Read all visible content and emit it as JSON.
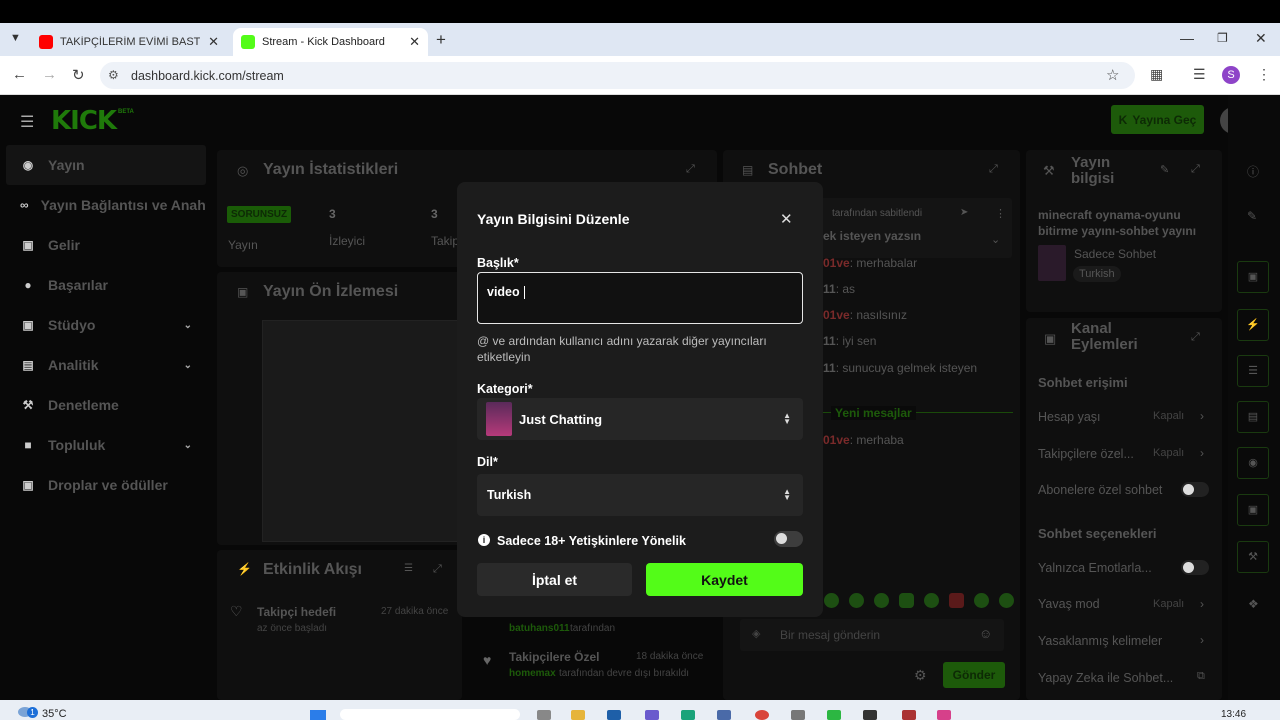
{
  "browser": {
    "tabs": [
      {
        "title": "TAKİPÇİLERİM EVİMİ BASTII | ST",
        "favicon": "youtube-icon"
      },
      {
        "title": "Stream - Kick Dashboard",
        "favicon": "kick-icon"
      }
    ],
    "url": "dashboard.kick.com/stream",
    "profile_initial": "S"
  },
  "header": {
    "logo": "KICK",
    "logo_badge": "BETA",
    "go_live_label": "Yayına Geç"
  },
  "sidebar": {
    "items": [
      {
        "label": "Yayın",
        "icon": "radio-icon"
      },
      {
        "label": "Yayın Bağlantısı ve Anahtarı",
        "icon": "link-icon"
      },
      {
        "label": "Gelir",
        "icon": "wallet-icon"
      },
      {
        "label": "Başarılar",
        "icon": "trophy-icon"
      },
      {
        "label": "Stüdyo",
        "icon": "studio-icon"
      },
      {
        "label": "Analitik",
        "icon": "chart-icon"
      },
      {
        "label": "Denetleme",
        "icon": "wrench-icon"
      },
      {
        "label": "Topluluk",
        "icon": "community-icon"
      },
      {
        "label": "Droplar ve ödüller",
        "icon": "gift-icon"
      }
    ]
  },
  "stats": {
    "title": "Yayın İstatistikleri",
    "status_badge": "SORUNSUZ",
    "status_label": "Yayın",
    "viewers_value": "3",
    "viewers_label": "İzleyici",
    "followers_value": "3",
    "followers_label": "Takip"
  },
  "preview": {
    "title": "Yayın Ön İzlemesi"
  },
  "activity": {
    "title": "Etkinlik Akışı",
    "items": [
      {
        "title": "Takipçi hedefi",
        "sub": "az önce başladı",
        "time": "27 dakika önce"
      }
    ]
  },
  "activity2": {
    "items": [
      {
        "user": "batuhans011",
        "sub": "tarafından"
      },
      {
        "title": "Takipçilere Özel",
        "user": "homemax",
        "sub": "tarafından devre dışı bırakıldı",
        "time": "18 dakika önce"
      }
    ]
  },
  "chat": {
    "title": "Sohbet",
    "pinned_by": "tarafından sabitlendi",
    "pinned_text": "ek isteyen yazsın",
    "messages": [
      {
        "user": "01ve",
        "text": ": merhabalar"
      },
      {
        "user": "11",
        "text": ": as"
      },
      {
        "user": "01ve",
        "text": ": nasılsınız"
      },
      {
        "user": "11",
        "text": ": iyi sen"
      },
      {
        "user": "11",
        "text": ": sunucuya gelmek isteyen"
      }
    ],
    "new_messages": "Yeni mesajlar",
    "last_message": {
      "user": "01ve",
      "text": ": merhaba"
    },
    "input_placeholder": "Bir mesaj gönderin",
    "send_label": "Gönder"
  },
  "stream_info": {
    "title": "Yayın bilgisi",
    "stream_title": "minecraft oynama-oyunu bitirme yayını-sohbet yayını",
    "category": "Sadece Sohbet",
    "language": "Turkish"
  },
  "channel_actions": {
    "title": "Kanal Eylemleri",
    "chat_access": "Sohbet erişimi",
    "account_age": "Hesap yaşı",
    "account_age_value": "Kapalı",
    "followers_only": "Takipçilere özel...",
    "followers_only_value": "Kapalı",
    "subs_only": "Abonelere özel sohbet",
    "chat_options": "Sohbet seçenekleri",
    "emotes_only": "Yalnızca Emotlarla...",
    "slow_mode": "Yavaş mod",
    "slow_mode_value": "Kapalı",
    "banned_words": "Yasaklanmış kelimeler",
    "ai_chat": "Yapay Zeka ile Sohbet..."
  },
  "modal": {
    "title": "Yayın Bilgisini Düzenle",
    "title_label": "Başlık*",
    "title_value": "video",
    "title_hint": "@ ve ardından kullanıcı adını yazarak diğer yayıncıları etiketleyin",
    "category_label": "Kategori*",
    "category_value": "Just Chatting",
    "language_label": "Dil*",
    "language_value": "Turkish",
    "mature_label": "Sadece 18+ Yetişkinlere Yönelik",
    "cancel_label": "İptal et",
    "save_label": "Kaydet"
  },
  "taskbar": {
    "temperature": "35°C",
    "weather_badge": "1",
    "time": "13:46"
  },
  "colors": {
    "kick_green": "#53fc18",
    "modal_bg": "#1c1c1c",
    "app_bg": "#080808"
  }
}
